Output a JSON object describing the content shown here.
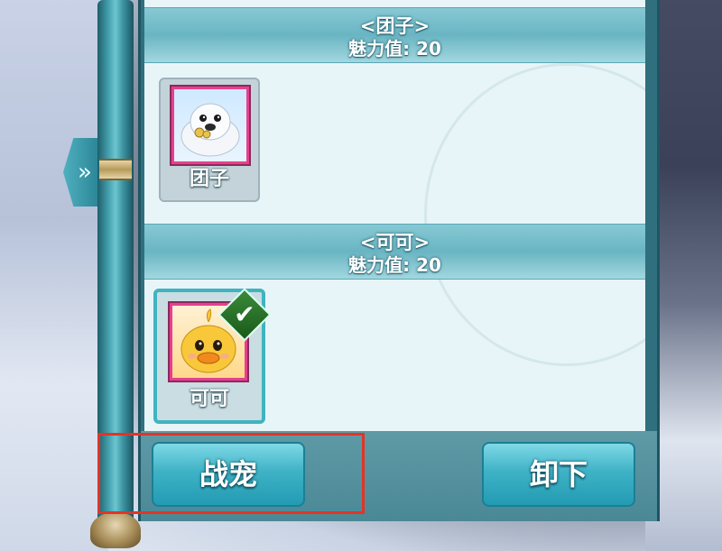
{
  "groups": [
    {
      "name": "<团子>",
      "charm": "魅力值: 20",
      "pet_label": "团子",
      "selected": false
    },
    {
      "name": "<可可>",
      "charm": "魅力值: 20",
      "pet_label": "可可",
      "selected": true
    }
  ],
  "side_tab": {
    "glyph": "»"
  },
  "buttons": {
    "battle_pet": "战宠",
    "unequip": "卸下"
  },
  "colors": {
    "highlight": "#e53324",
    "panel": "#e8f5f8",
    "button": "#3fb2c6",
    "frame": "#e6408f"
  },
  "icons": {
    "check": "✔"
  }
}
